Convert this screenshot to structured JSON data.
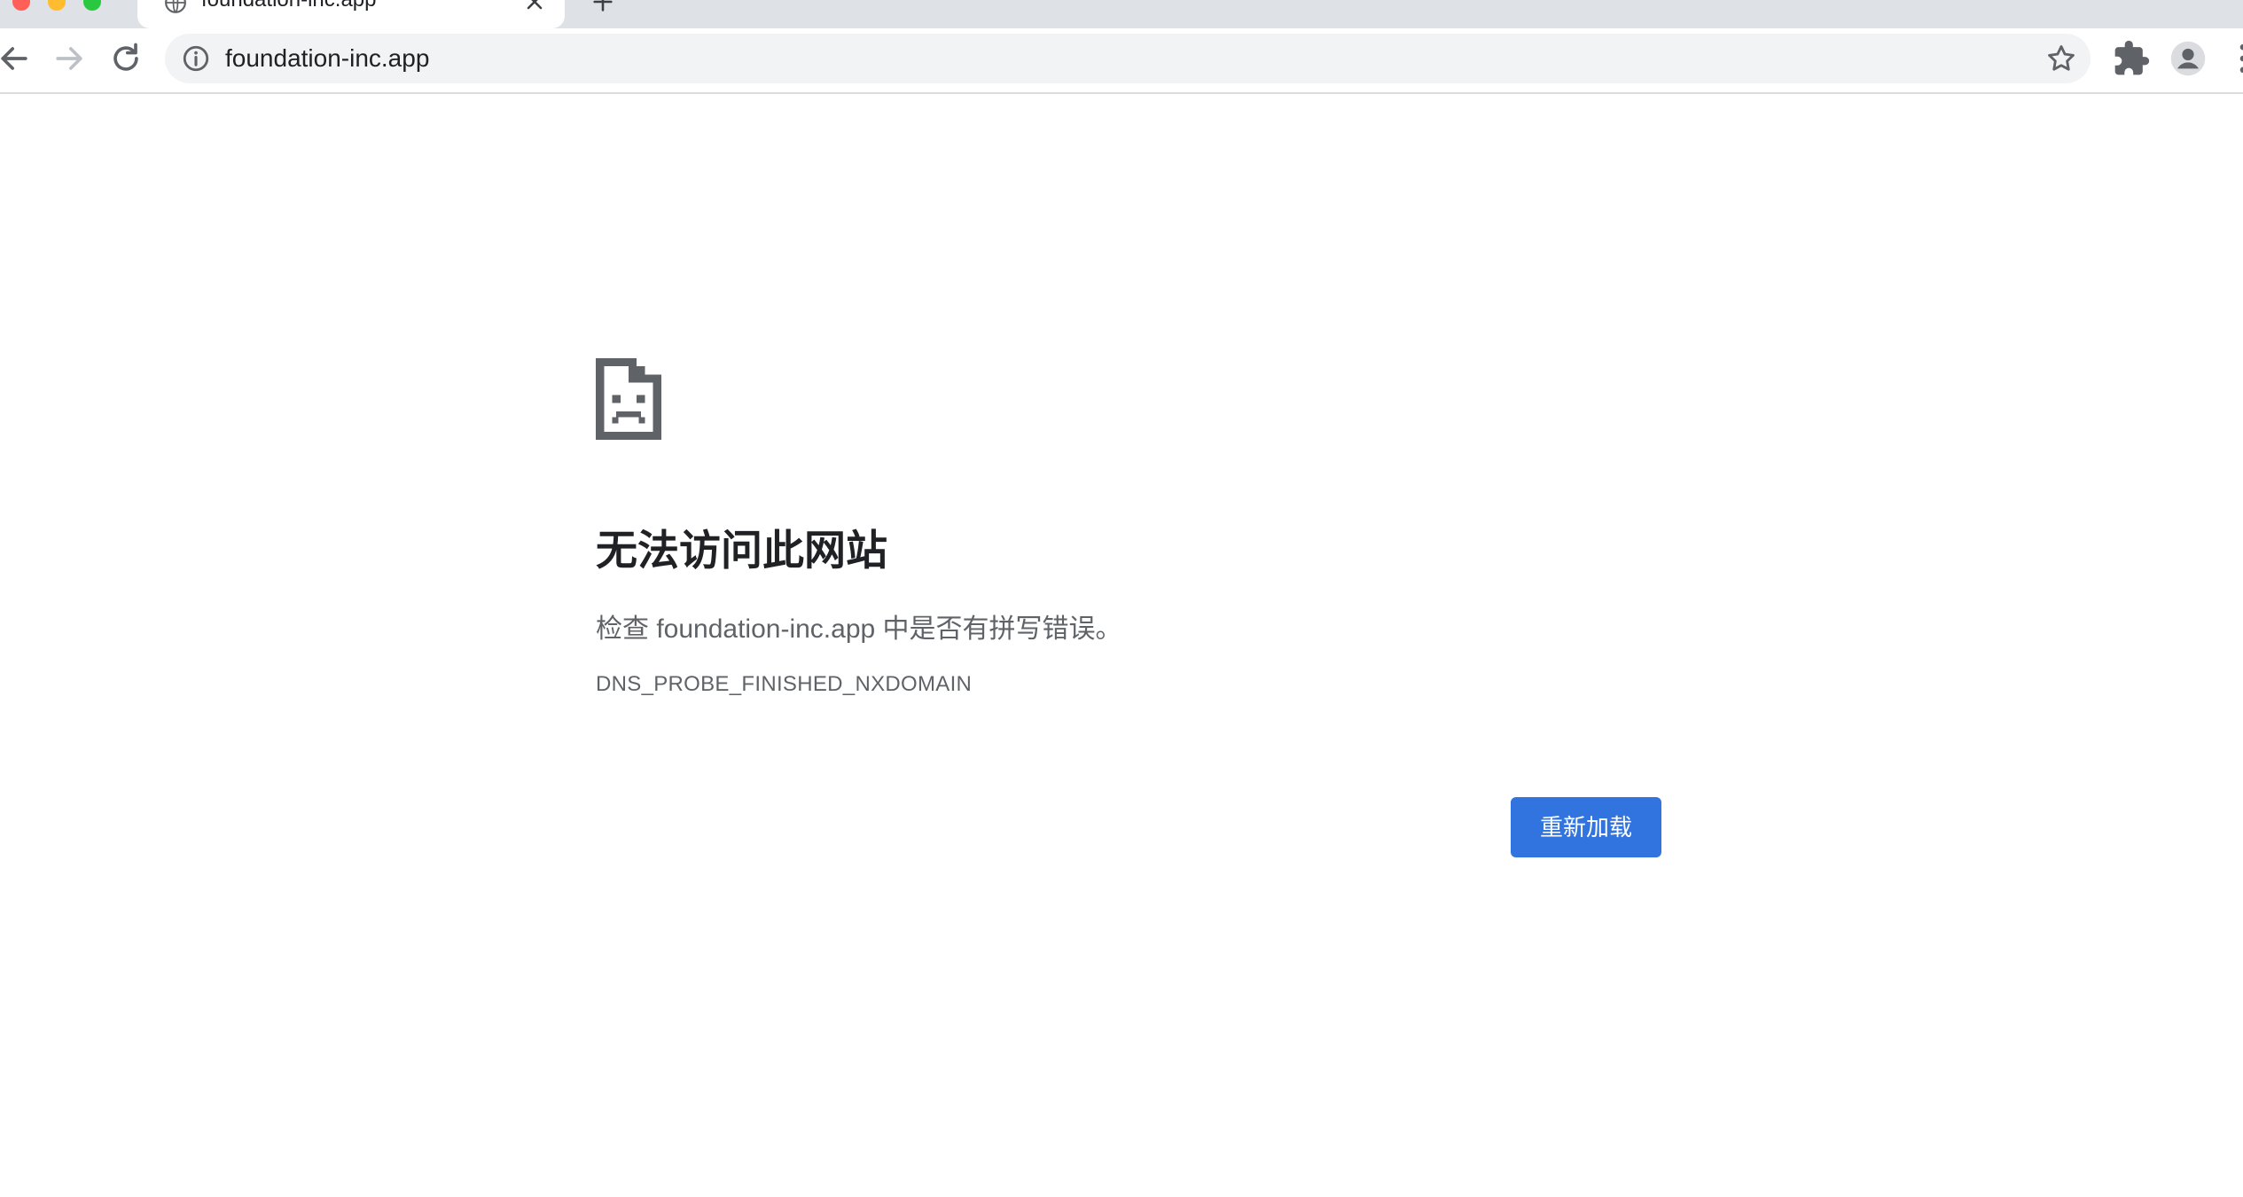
{
  "window": {
    "traffic_light_colors": [
      "#ff5f57",
      "#febc2e",
      "#28c840"
    ]
  },
  "tab": {
    "title": "foundation-inc.app",
    "favicon": "globe-icon",
    "close_icon": "close-icon"
  },
  "toolbar": {
    "back_icon": "arrow-left-icon",
    "forward_icon": "arrow-right-icon",
    "reload_icon": "reload-icon",
    "extensions_icon": "puzzle-icon",
    "profile_icon": "account-icon",
    "menu_icon": "kebab-menu-icon"
  },
  "omnibox": {
    "url": "foundation-inc.app",
    "info_icon": "info-icon",
    "bookmark_icon": "star-icon"
  },
  "error_page": {
    "icon": "sad-document-icon",
    "title": "无法访问此网站",
    "description": "检查 foundation-inc.app 中是否有拼写错误。",
    "error_code": "DNS_PROBE_FINISHED_NXDOMAIN",
    "reload_button_label": "重新加载",
    "accent_color": "#3174df"
  }
}
